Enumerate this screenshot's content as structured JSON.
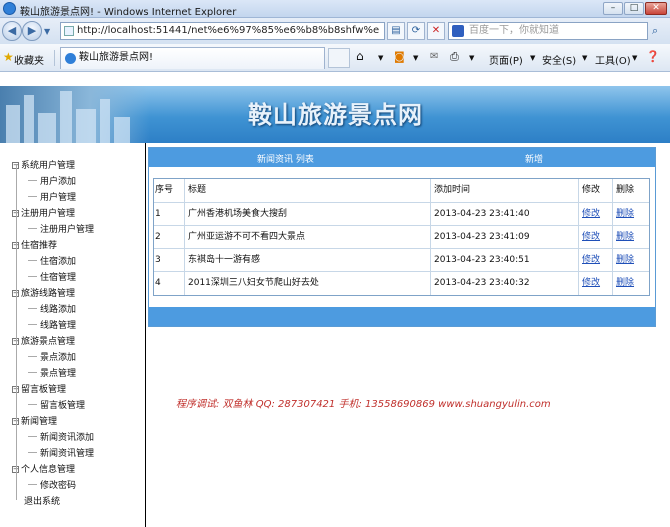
{
  "window": {
    "title": "鞍山旅游景点网! - Windows Internet Explorer"
  },
  "address": {
    "url": "http://localhost:51441/net%e6%97%85%e6%b8%b8shfw%e",
    "search_placeholder": "百度一下，你就知道"
  },
  "favorites": {
    "label": "收藏夹",
    "tab_title": "鞍山旅游景点网!"
  },
  "commands": {
    "page": "页面(P)",
    "safety": "安全(S)",
    "tools": "工具(O)"
  },
  "site": {
    "title": "鞍山旅游景点网"
  },
  "sidebar": {
    "groups": [
      {
        "label": "系统用户管理",
        "children": [
          "用户添加",
          "用户管理"
        ]
      },
      {
        "label": "注册用户管理",
        "children": [
          "注册用户管理"
        ]
      },
      {
        "label": "住宿推荐",
        "children": [
          "住宿添加",
          "住宿管理"
        ]
      },
      {
        "label": "旅游线路管理",
        "children": [
          "线路添加",
          "线路管理"
        ]
      },
      {
        "label": "旅游景点管理",
        "children": [
          "景点添加",
          "景点管理"
        ]
      },
      {
        "label": "留言板管理",
        "children": [
          "留言板管理"
        ]
      },
      {
        "label": "新闻管理",
        "children": [
          "新闻资讯添加",
          "新闻资讯管理"
        ]
      },
      {
        "label": "个人信息管理",
        "children": [
          "修改密码"
        ]
      }
    ],
    "logout": "退出系统"
  },
  "list": {
    "header_title": "新闻资讯 列表",
    "add_label": "新增",
    "columns": [
      "序号",
      "标题",
      "添加时间",
      "修改",
      "删除"
    ],
    "rows": [
      {
        "no": "1",
        "title": "广州香港机场美食大搜刮",
        "time": "2013-04-23 23:41:40",
        "edit": "修改",
        "del": "删除"
      },
      {
        "no": "2",
        "title": "广州亚运游不可不看四大景点",
        "time": "2013-04-23 23:41:09",
        "edit": "修改",
        "del": "删除"
      },
      {
        "no": "3",
        "title": "东褀岛十一游有感",
        "time": "2013-04-23 23:40:51",
        "edit": "修改",
        "del": "删除"
      },
      {
        "no": "4",
        "title": "2011深圳三八妇女节爬山好去处",
        "time": "2013-04-23 23:40:32",
        "edit": "修改",
        "del": "删除"
      }
    ]
  },
  "footer": {
    "text": "程序调试: 双鱼林   QQ: 287307421   手机: 13558690869   www.shuangyulin.com"
  },
  "colors": {
    "accent": "#4d9be0",
    "link": "#1f4fb8",
    "footer": "#c0302c"
  }
}
